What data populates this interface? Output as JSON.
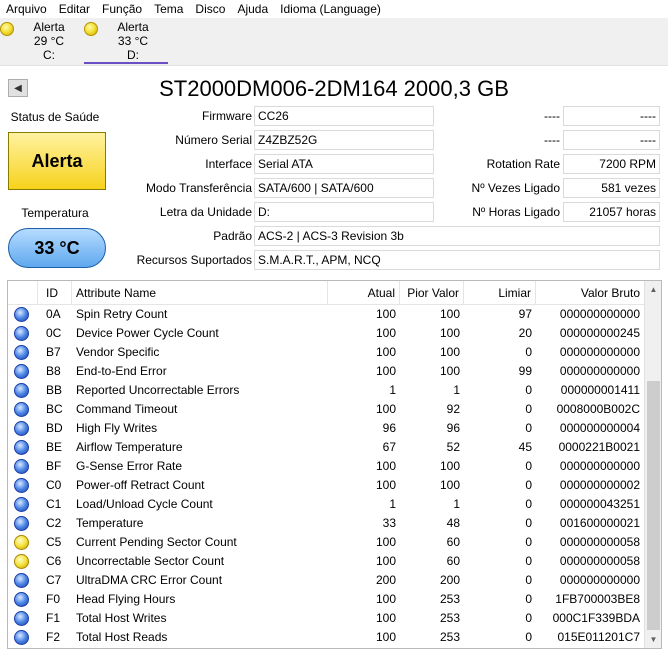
{
  "menu": [
    "Arquivo",
    "Editar",
    "Função",
    "Tema",
    "Disco",
    "Ajuda",
    "Idioma (Language)"
  ],
  "drives": [
    {
      "status": "Alerta",
      "temp": "29 °C",
      "letter": "C:"
    },
    {
      "status": "Alerta",
      "temp": "33 °C",
      "letter": "D:"
    }
  ],
  "title": "ST2000DM006-2DM164 2000,3 GB",
  "health": {
    "label": "Status de Saúde",
    "value": "Alerta",
    "color": "#f7d21c"
  },
  "temperature": {
    "label": "Temperatura",
    "value": "33 °C",
    "color": "#5ea8ef"
  },
  "info": {
    "firmware_label": "Firmware",
    "firmware": "CC26",
    "serial_label": "Número Serial",
    "serial": "Z4ZBZ52G",
    "interface_label": "Interface",
    "interface": "Serial ATA",
    "transfer_label": "Modo Transferência",
    "transfer": "SATA/600 | SATA/600",
    "letter_label": "Letra da Unidade",
    "letter": "D:",
    "standard_label": "Padrão",
    "standard": "ACS-2 | ACS-3 Revision 3b",
    "features_label": "Recursos Suportados",
    "features": "S.M.A.R.T., APM, NCQ",
    "r1_label": "----",
    "r1": "----",
    "r2_label": "----",
    "r2": "----",
    "rotation_label": "Rotation Rate",
    "rotation": "7200 RPM",
    "power_count_label": "Nº Vezes Ligado",
    "power_count": "581 vezes",
    "power_hours_label": "Nº Horas Ligado",
    "power_hours": "21057 horas"
  },
  "table": {
    "headers": {
      "id": "ID",
      "name": "Attribute Name",
      "current": "Atual",
      "worst": "Pior Valor",
      "threshold": "Limiar",
      "raw": "Valor Bruto"
    },
    "rows": [
      {
        "status": "blue",
        "id": "0A",
        "name": "Spin Retry Count",
        "current": "100",
        "worst": "100",
        "threshold": "97",
        "raw": "000000000000"
      },
      {
        "status": "blue",
        "id": "0C",
        "name": "Device Power Cycle Count",
        "current": "100",
        "worst": "100",
        "threshold": "20",
        "raw": "000000000245"
      },
      {
        "status": "blue",
        "id": "B7",
        "name": "Vendor Specific",
        "current": "100",
        "worst": "100",
        "threshold": "0",
        "raw": "000000000000"
      },
      {
        "status": "blue",
        "id": "B8",
        "name": "End-to-End Error",
        "current": "100",
        "worst": "100",
        "threshold": "99",
        "raw": "000000000000"
      },
      {
        "status": "blue",
        "id": "BB",
        "name": "Reported Uncorrectable Errors",
        "current": "1",
        "worst": "1",
        "threshold": "0",
        "raw": "000000001411"
      },
      {
        "status": "blue",
        "id": "BC",
        "name": "Command Timeout",
        "current": "100",
        "worst": "92",
        "threshold": "0",
        "raw": "0008000B002C"
      },
      {
        "status": "blue",
        "id": "BD",
        "name": "High Fly Writes",
        "current": "96",
        "worst": "96",
        "threshold": "0",
        "raw": "000000000004"
      },
      {
        "status": "blue",
        "id": "BE",
        "name": "Airflow Temperature",
        "current": "67",
        "worst": "52",
        "threshold": "45",
        "raw": "0000221B0021"
      },
      {
        "status": "blue",
        "id": "BF",
        "name": "G-Sense Error Rate",
        "current": "100",
        "worst": "100",
        "threshold": "0",
        "raw": "000000000000"
      },
      {
        "status": "blue",
        "id": "C0",
        "name": "Power-off Retract Count",
        "current": "100",
        "worst": "100",
        "threshold": "0",
        "raw": "000000000002"
      },
      {
        "status": "blue",
        "id": "C1",
        "name": "Load/Unload Cycle Count",
        "current": "1",
        "worst": "1",
        "threshold": "0",
        "raw": "000000043251"
      },
      {
        "status": "blue",
        "id": "C2",
        "name": "Temperature",
        "current": "33",
        "worst": "48",
        "threshold": "0",
        "raw": "001600000021"
      },
      {
        "status": "yellow",
        "id": "C5",
        "name": "Current Pending Sector Count",
        "current": "100",
        "worst": "60",
        "threshold": "0",
        "raw": "000000000058"
      },
      {
        "status": "yellow",
        "id": "C6",
        "name": "Uncorrectable Sector Count",
        "current": "100",
        "worst": "60",
        "threshold": "0",
        "raw": "000000000058"
      },
      {
        "status": "blue",
        "id": "C7",
        "name": "UltraDMA CRC Error Count",
        "current": "200",
        "worst": "200",
        "threshold": "0",
        "raw": "000000000000"
      },
      {
        "status": "blue",
        "id": "F0",
        "name": "Head Flying Hours",
        "current": "100",
        "worst": "253",
        "threshold": "0",
        "raw": "1FB700003BE8"
      },
      {
        "status": "blue",
        "id": "F1",
        "name": "Total Host Writes",
        "current": "100",
        "worst": "253",
        "threshold": "0",
        "raw": "000C1F339BDA"
      },
      {
        "status": "blue",
        "id": "F2",
        "name": "Total Host Reads",
        "current": "100",
        "worst": "253",
        "threshold": "0",
        "raw": "015E011201C7"
      }
    ]
  }
}
